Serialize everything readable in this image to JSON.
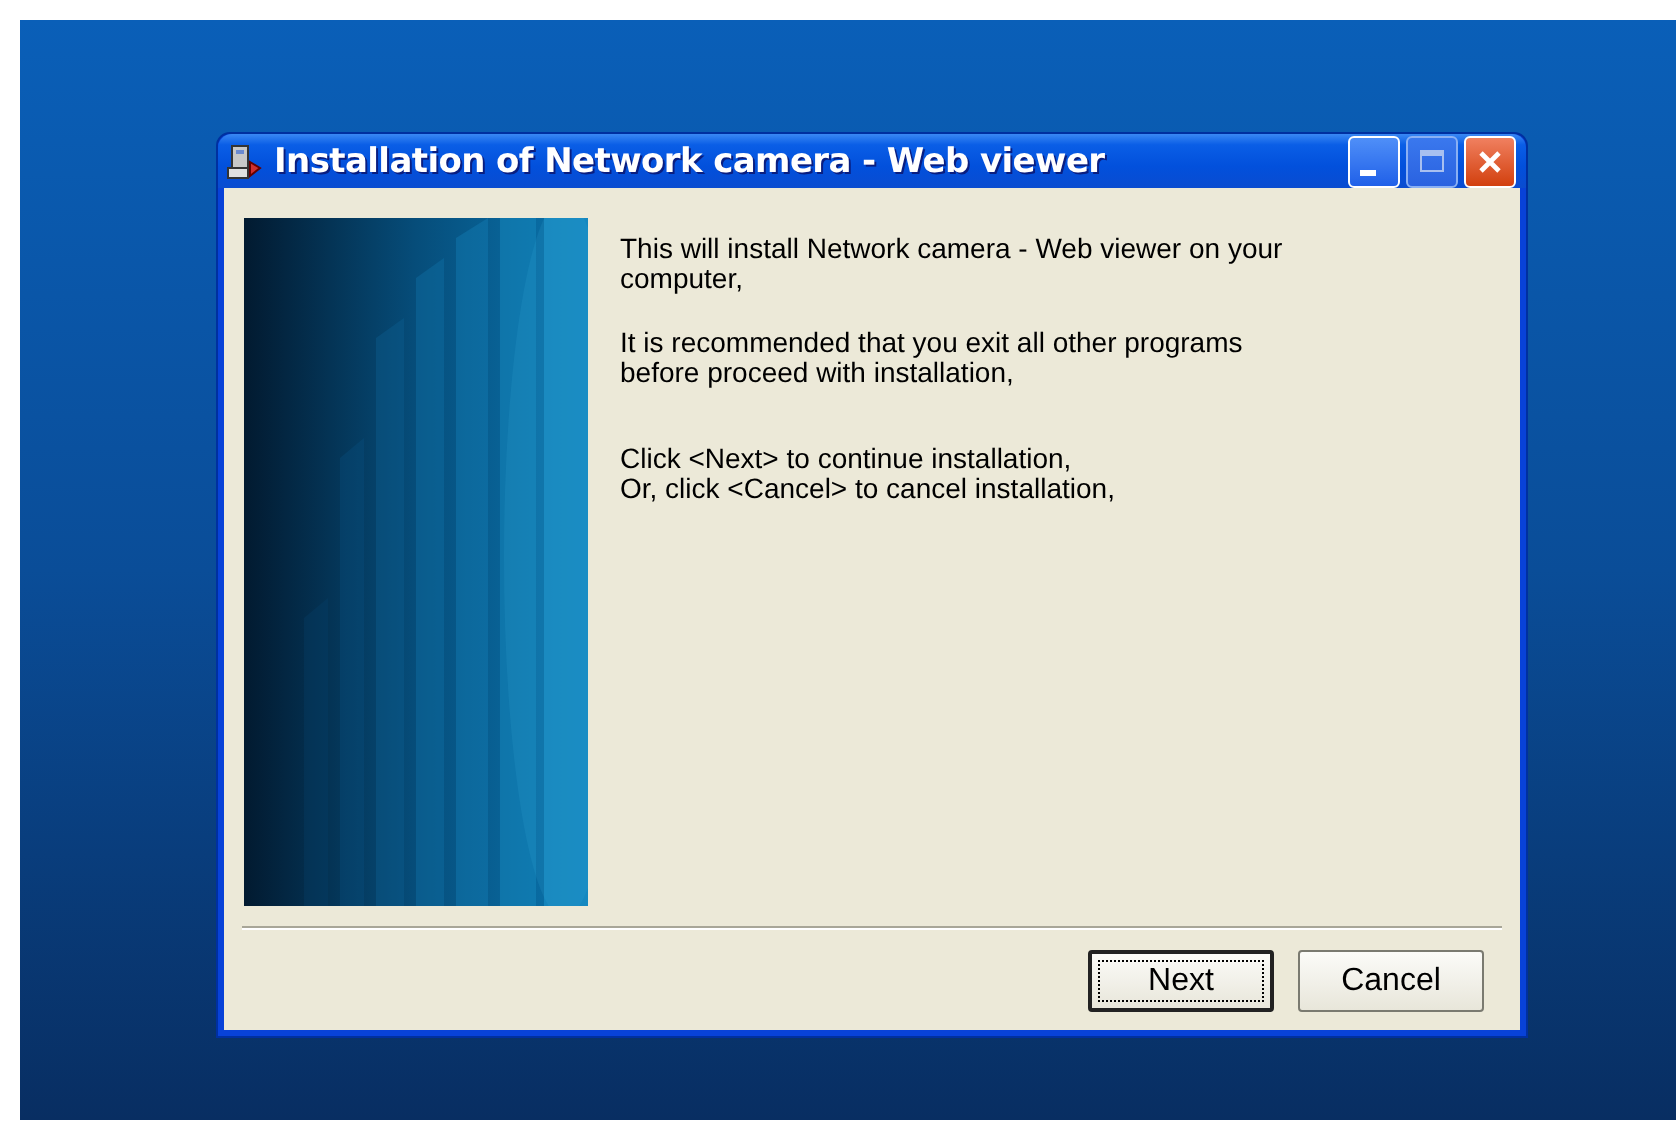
{
  "window": {
    "title": "Installation of Network camera - Web viewer"
  },
  "banner": {
    "kind": "picture"
  },
  "paragraphs": [
    [
      "This will install Network camera - Web viewer on your",
      "computer,"
    ],
    [
      "It is recommended that you exit all other programs",
      "before proceed with installation,"
    ],
    [
      "Click <Next> to continue installation,",
      "Or, click <Cancel> to cancel installation,"
    ]
  ],
  "buttons": [
    {
      "label": "Next",
      "default": true
    },
    {
      "label": "Cancel",
      "default": false
    }
  ]
}
